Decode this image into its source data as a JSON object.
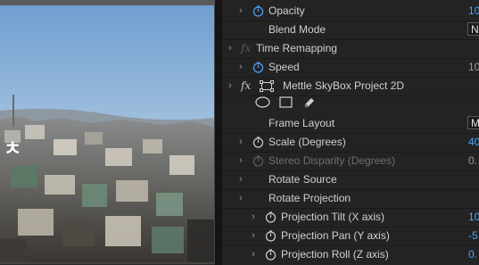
{
  "monitor": {
    "overlay_text": "ㅊ"
  },
  "effect_controls": {
    "rows": [
      {
        "twirl": "›",
        "stopwatch": "active",
        "label": "Opacity",
        "value": "10",
        "value_style": "blue"
      },
      {
        "label": "Blend Mode",
        "value": "N",
        "value_style": "dropdown"
      },
      {
        "twirl": "›",
        "fx": "fx",
        "fx_dim": true,
        "label": "Time Remapping",
        "label_dim": true
      },
      {
        "twirl": "›",
        "stopwatch": "active",
        "label": "Speed",
        "value": "10",
        "value_style": "grey"
      },
      {
        "twirl": "›",
        "fx": "fx",
        "label": "Mettle SkyBox Project 2D"
      },
      {
        "label": "Frame Layout",
        "value": "M",
        "value_style": "dropdown"
      },
      {
        "twirl": "›",
        "stopwatch": "idle",
        "label": "Scale (Degrees)",
        "value": "40",
        "value_style": "blue"
      },
      {
        "twirl": "›",
        "stopwatch": "dim",
        "label": "Stereo Disparity (Degrees)",
        "label_dim": true,
        "value": "0.",
        "value_style": "grey"
      },
      {
        "twirl": "›",
        "label": "Rotate Source"
      },
      {
        "twirl": "›",
        "label": "Rotate Projection"
      },
      {
        "twirl": "›",
        "stopwatch": "idle",
        "label": "Projection Tilt (X axis)",
        "value": "10",
        "value_style": "blue"
      },
      {
        "twirl": "›",
        "stopwatch": "idle",
        "label": "Projection Pan (Y axis)",
        "value": "-5",
        "value_style": "blue"
      },
      {
        "twirl": "›",
        "stopwatch": "idle",
        "label": "Projection Roll (Z axis)",
        "value": "0.",
        "value_style": "blue"
      }
    ],
    "mask_tools": [
      "ellipse-mask-icon",
      "rectangle-mask-icon",
      "pen-mask-icon"
    ]
  },
  "colors": {
    "panel_bg": "#232323",
    "accent_blue": "#4aa3f0",
    "text": "#d0d0d0",
    "text_dim": "#6f6f6f"
  }
}
